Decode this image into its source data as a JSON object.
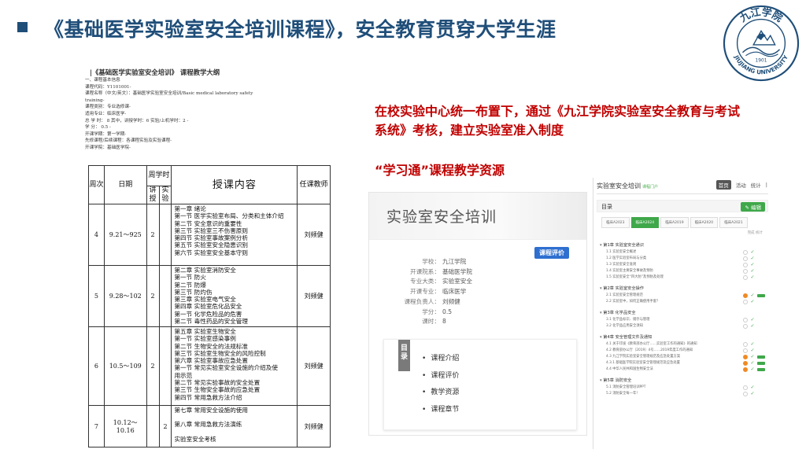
{
  "header": {
    "title": "《基础医学实验室安全培训课程》，安全教育贯穿大学生涯",
    "logo": {
      "text_top": "九江学院",
      "text_bottom": "JIUJIANG UNIVERSITY",
      "year": "1901",
      "icon": "university-seal-icon",
      "color": "#1f4e79"
    }
  },
  "syllabus": {
    "title": "|《基础医学实验室安全培训》 课程教学大纲",
    "lines": [
      "一、课程基本信息",
      "课程代码：Y1101001-",
      "课程名称（中文/英文）：基础医学实验室安全培训/Basic medical laboratory safety",
      "training-",
      "课程类别：专业选修课-",
      "适用专业：临床医学-",
      "总 学 时： 8  其中，讲授学时：6  实验/上机学时：2 -",
      "学    分：   0.5  -",
      "开课学期：第一学期-",
      "先修课程/后续课程：各课程实验及实验课程-",
      "开课学院：基础医学院-"
    ],
    "table": {
      "headers": {
        "week": "周次",
        "date": "日期",
        "hours": "周学时",
        "lecture": "讲授",
        "lab": "实验",
        "content": "授课内容",
        "teacher": "任课教师"
      },
      "rows": [
        {
          "week": "4",
          "date": "9.21～925",
          "lecture": "2",
          "lab": "",
          "teacher": "刘频健",
          "content": [
            "第一章 绪论",
            "第一节 医学实验室布局、分类和主体介绍",
            "第二节 安全意识的重要性",
            "第三节 实验室三不伤害原则",
            "第四节 实验室事故案例分析",
            "第五节 实验室安全隐患识别",
            "第六节 实验室安全基本守则"
          ]
        },
        {
          "week": "5",
          "date": "9.28～102",
          "lecture": "2",
          "lab": "",
          "teacher": "刘频健",
          "content": [
            "第二章 实验室消防安全",
            "第一节 防火",
            "第二节 防爆",
            "第三节 防灼伤",
            "第三章 实验室电气安全",
            "第四章 实验室危化品安全",
            "第一节 化学危险品的危害",
            "第二节 毒性药品的安全管理"
          ]
        },
        {
          "week": "6",
          "date": "10.5～109",
          "lecture": "2",
          "lab": "",
          "teacher": "刘频健",
          "content": [
            "第五章 实验室生物安全",
            "第一节 实验室感染事例",
            "第二节 生物安全的法规标准",
            "第三节 实验室生物安全的风险控制",
            "第六章 实验室事故应急处置",
            "第一节 常见实验室安全设施的介绍及使",
            "用示范",
            "第二节 常见实验事故的安全处置",
            "第三节 生物安全事故的应急处置",
            "第四节 常用急救方法介绍"
          ]
        },
        {
          "week": "7",
          "date": "10.12～10.16",
          "lecture": "",
          "lab": "2",
          "teacher": "刘频健",
          "content": [
            "第七章 常用安全设施的使用",
            "",
            "第八章 常用急救方法演练",
            "",
            "实验室安全考核"
          ]
        }
      ]
    }
  },
  "notice": {
    "text": "在校实验中心统一布置下，通过《九江学院实验室安全教育与考试系统》考核，建立实验室准入制度",
    "subtitle": "“学习通”课程教学资源"
  },
  "course_card": {
    "title": "实验室安全培训",
    "eval_button": "课程评价",
    "info": [
      {
        "k": "学校：",
        "v": "九江学院"
      },
      {
        "k": "开课院系：",
        "v": "基础医学院"
      },
      {
        "k": "专业大类：",
        "v": "实验室安全"
      },
      {
        "k": "开课专业：",
        "v": "临床医学"
      },
      {
        "k": "课程负责人：",
        "v": "刘频健"
      },
      {
        "k": "学分：",
        "v": "0.5"
      },
      {
        "k": "课时：",
        "v": "8"
      }
    ],
    "toc_tab": "目录",
    "toc": [
      "课程介绍",
      "课程评价",
      "教学资源",
      "课程章节"
    ]
  },
  "platform": {
    "course_name": "实验室安全培训",
    "course_tag": "课程门户",
    "nav": [
      "首页",
      "活动",
      "统计"
    ],
    "toc_title": "目录",
    "edit_button": "✎ 编辑",
    "tabs": [
      "临床A2023",
      "临床A2024",
      "临床A2019",
      "临床A2020",
      "临床A2021"
    ],
    "selected_tab": 1,
    "columns": "完成  统计",
    "accent": "#3fa84a",
    "chapters": [
      {
        "title": "第1章 实验室安全通识",
        "sections": [
          {
            "t": "1.1  实验室安全概述",
            "o": false,
            "b": false
          },
          {
            "t": "1.2  医学实验室布局与分类",
            "o": false,
            "b": false
          },
          {
            "t": "1.3  实验室安全准则",
            "o": false,
            "b": false
          },
          {
            "t": "1.4  实验室主要安全事故及预防",
            "o": false,
            "b": false
          },
          {
            "t": "1.5  实验室安全“四大防”及预防及处理",
            "o": false,
            "b": false
          }
        ]
      },
      {
        "title": "第2章 实验室安全操作",
        "sections": [
          {
            "t": "2.1  实验室安全管理规范",
            "o": true,
            "b": true
          },
          {
            "t": "2.2  实验室中，如何正确使用手套？",
            "o": false,
            "b": false
          }
        ]
      },
      {
        "title": "第3章 化学品安全",
        "sections": [
          {
            "t": "3.1  化学品标识、储存与管理",
            "o": false,
            "b": false
          },
          {
            "t": "3.2  化学品应用安全须知",
            "o": false,
            "b": false
          }
        ]
      },
      {
        "title": "第4章 安全管理文件及通知",
        "sections": [
          {
            "t": "4.1  关于印发《教育部办公厅……实验室工作的通知》的通知",
            "o": false,
            "b": false
          },
          {
            "t": "4.2  教育部办公厅〔2019〕4号……2019年度工作的通知",
            "o": false,
            "b": false
          },
          {
            "t": "4.3  九江学院实验室安全管理规范及应急处置方案",
            "o": true,
            "b": true
          },
          {
            "t": "4.3.1  基础医学院实验室安全管理规范及应急处置",
            "o": true,
            "b": true
          },
          {
            "t": "4.4  中华人民共和国生物安全法",
            "o": true,
            "b": true
          }
        ]
      },
      {
        "title": "第5章 消防安全",
        "sections": [
          {
            "t": "5.1  消防安全管理培训PPT",
            "o": false,
            "b": false
          },
          {
            "t": "5.2  消防安全每一年！",
            "o": false,
            "b": false
          }
        ]
      }
    ]
  }
}
